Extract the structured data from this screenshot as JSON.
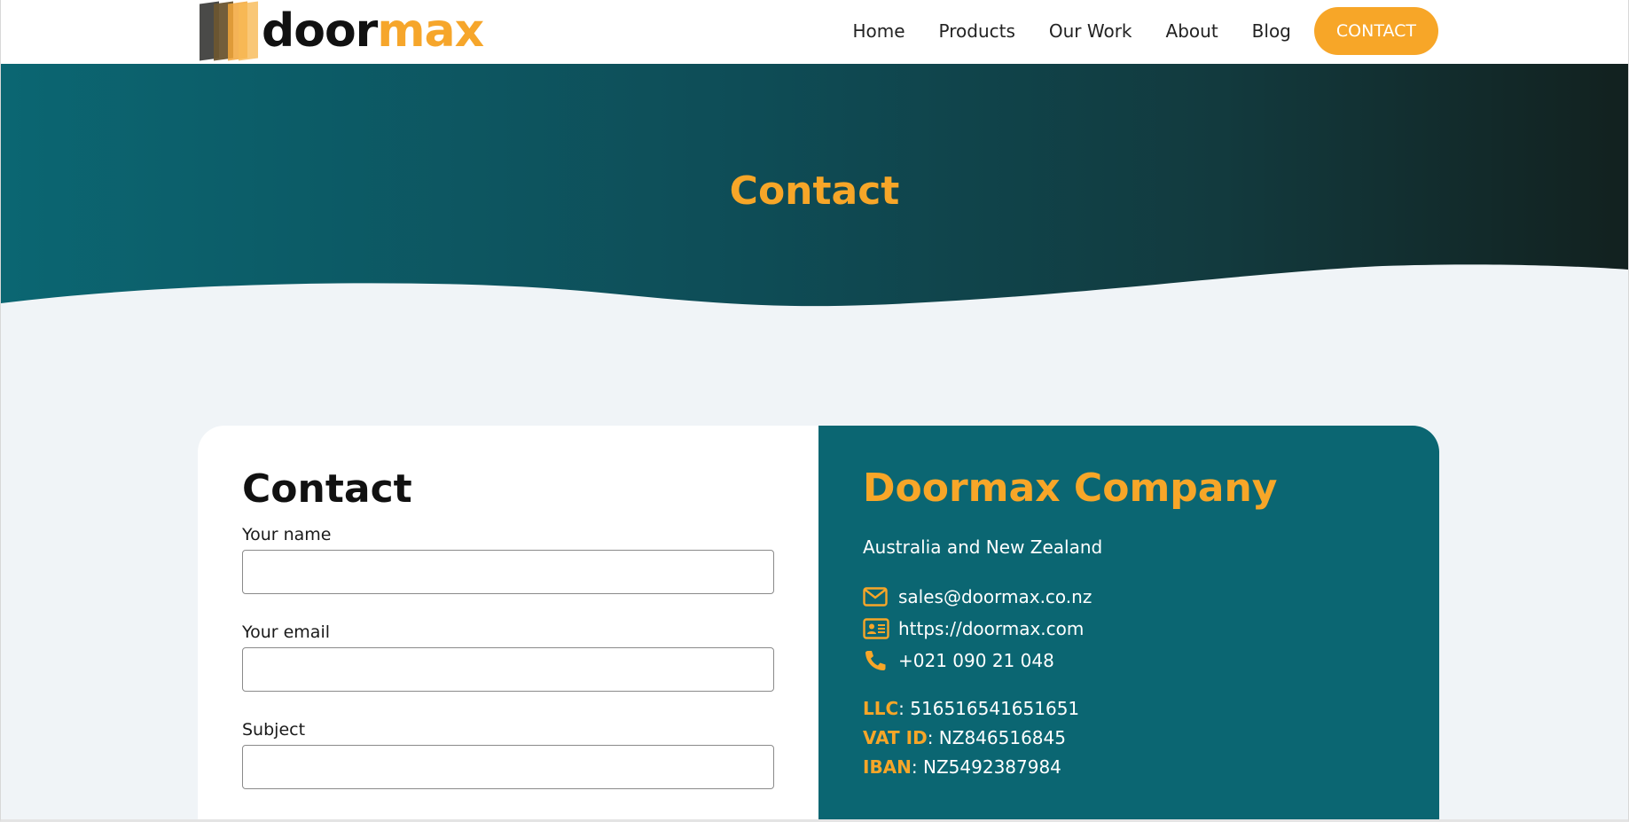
{
  "header": {
    "logo": {
      "part1": "door",
      "part2": "max"
    },
    "nav": [
      {
        "label": "Home"
      },
      {
        "label": "Products"
      },
      {
        "label": "Our Work"
      },
      {
        "label": "About"
      },
      {
        "label": "Blog"
      }
    ],
    "cta_label": "CONTACT"
  },
  "hero": {
    "title": "Contact"
  },
  "form": {
    "title": "Contact",
    "fields": [
      {
        "label": "Your name",
        "value": ""
      },
      {
        "label": "Your email",
        "value": ""
      },
      {
        "label": "Subject",
        "value": ""
      }
    ]
  },
  "company": {
    "name": "Doormax Company",
    "region": "Australia and New Zealand",
    "email": "sales@doormax.co.nz",
    "website": "https://doormax.com",
    "phone": "+021 090 21 048",
    "llc_label": "LLC",
    "llc_value": ": 516516541651651",
    "vat_label": "VAT ID",
    "vat_value": ": NZ846516845",
    "iban_label": "IBAN",
    "iban_value": ": NZ5492387984"
  },
  "icons": {
    "email": "envelope-icon",
    "website": "id-card-icon",
    "phone": "phone-icon"
  },
  "colors": {
    "accent": "#f7a628",
    "teal": "#0b6672",
    "hero_dark": "#12211f",
    "page_bg": "#f0f4f7"
  }
}
